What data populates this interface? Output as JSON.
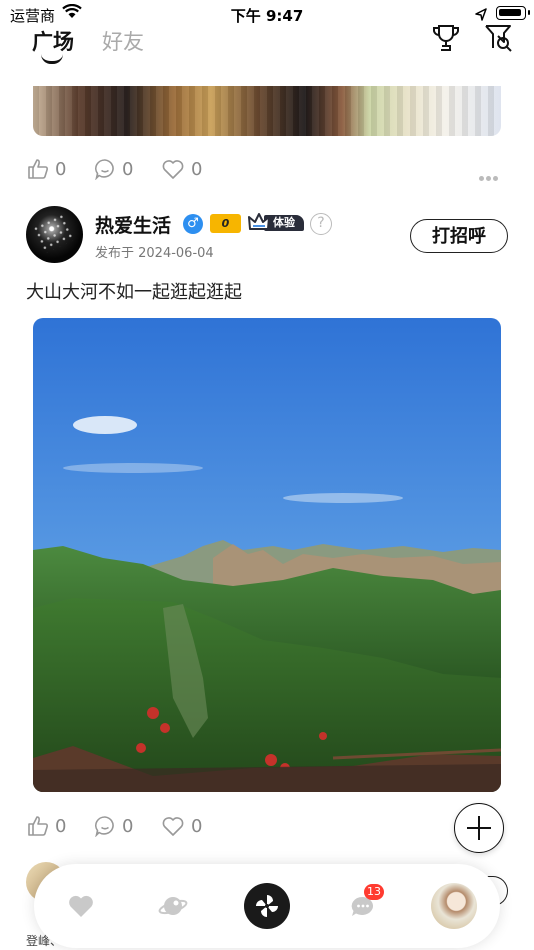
{
  "status_bar": {
    "carrier": "运营商",
    "time": "下午 9:47",
    "wifi_icon": "wifi-icon",
    "location_icon": "location-arrow-icon",
    "battery_icon": "battery-icon"
  },
  "top_nav": {
    "tabs": [
      {
        "label": "广场",
        "active": true
      },
      {
        "label": "好友",
        "active": false
      }
    ],
    "trophy_icon": "trophy-icon",
    "flag_search_icon": "flag-search-icon"
  },
  "previous_post": {
    "likes": "0",
    "comments": "0",
    "favorites": "0"
  },
  "post": {
    "username": "热爱生活",
    "gender_symbol": "♂",
    "level": "0",
    "badge": "体验",
    "help": "?",
    "date": "发布于 2024-06-04",
    "greet_button": "打招呼",
    "text": "大山大河不如一起逛起逛起",
    "photo_description_icon": "mountain-photo",
    "likes": "0",
    "comments": "0",
    "favorites": "0"
  },
  "next_post": {
    "name_partial": "登峰、"
  },
  "bottom_bar": {
    "items": [
      "heart-icon",
      "planet-icon",
      "pinwheel-icon",
      "chat-icon",
      "profile-avatar"
    ],
    "message_badge": "13"
  },
  "colors": {
    "accent_blue": "#2d8ff0",
    "level_gold": "#f7b500",
    "badge_red": "#ff3b30"
  }
}
